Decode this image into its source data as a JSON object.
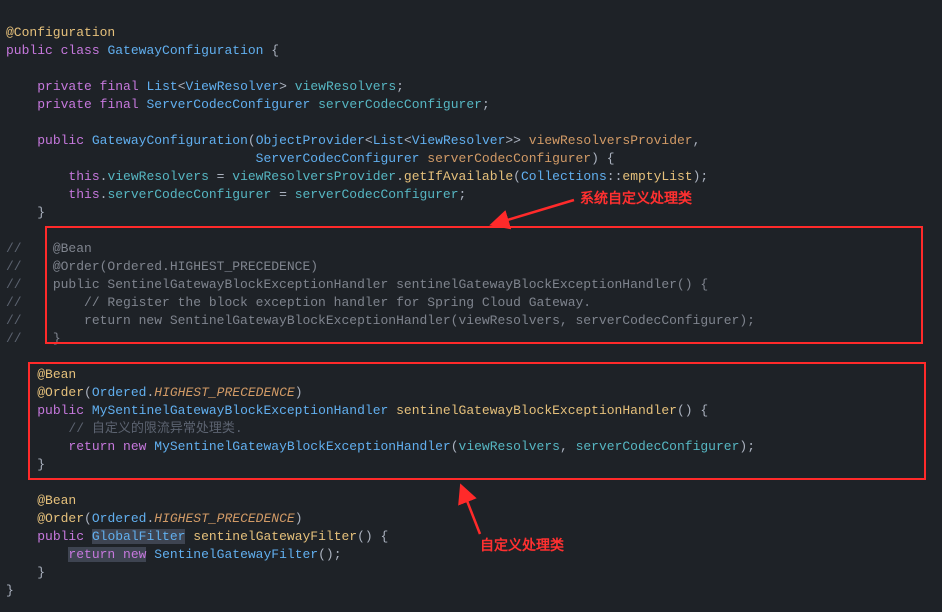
{
  "code": {
    "l1_ann": "@Configuration",
    "l2_kw_public": "public",
    "l2_kw_class": "class",
    "l2_type": "GatewayConfiguration",
    "l2_brace": " {",
    "l4_private": "private",
    "l4_final": "final",
    "l4_list": "List",
    "l4_vr": "ViewResolver",
    "l4_field": "viewResolvers",
    "l5_private": "private",
    "l5_final": "final",
    "l5_scc": "ServerCodecConfigurer",
    "l5_field": "serverCodecConfigurer",
    "l7_public": "public",
    "l7_ctor": "GatewayConfiguration",
    "l7_op": "ObjectProvider",
    "l7_list": "List",
    "l7_vr": "ViewResolver",
    "l7_p1": "viewResolversProvider",
    "l8_scc": "ServerCodecConfigurer",
    "l8_p2": "serverCodecConfigurer",
    "l8_brace": ") {",
    "l9_this": "this",
    "l9_vr": "viewResolvers",
    "l9_eq": " = ",
    "l9_p": "viewResolversProvider",
    "l9_m": "getIfAvailable",
    "l9_coll": "Collections",
    "l9_el": "emptyList",
    "l10_this": "this",
    "l10_scc": "serverCodecConfigurer",
    "l10_eq": " = ",
    "l10_p": "serverCodecConfigurer",
    "l11_brace": "}",
    "c_slash": "//",
    "c_bean": "    @Bean",
    "c_order": "    @Order(Ordered.HIGHEST_PRECEDENCE)",
    "c_sig": "    public SentinelGatewayBlockExceptionHandler sentinelGatewayBlockExceptionHandler() {",
    "c_reg": "        // Register the block exception handler for Spring Cloud Gateway.",
    "c_ret": "        return new SentinelGatewayBlockExceptionHandler(viewResolvers, serverCodecConfigurer);",
    "c_end": "    }",
    "b_bean": "@Bean",
    "b_order": "@Order",
    "b_ordered": "Ordered",
    "b_hp": "HIGHEST_PRECEDENCE",
    "b_public": "public",
    "b_type": "MySentinelGatewayBlockExceptionHandler",
    "b_mname": "sentinelGatewayBlockExceptionHandler",
    "b_brace": "() {",
    "b_cmt": "// 自定义的限流异常处理类.",
    "b_return": "return",
    "b_new": "new",
    "b_ctor": "MySentinelGatewayBlockExceptionHandler",
    "b_a1": "viewResolvers",
    "b_a2": "serverCodecConfigurer",
    "b_end": "}",
    "g_bean": "@Bean",
    "g_order": "@Order",
    "g_ordered": "Ordered",
    "g_hp": "HIGHEST_PRECEDENCE",
    "g_public": "public",
    "g_gf": "GlobalFilter",
    "g_mname": "sentinelGatewayFilter",
    "g_brace": "() {",
    "g_return": "return",
    "g_new": "new",
    "g_ctor": "SentinelGatewayFilter",
    "g_end": "}",
    "final_brace": "}"
  },
  "labels": {
    "sys": "系统自定义处理类",
    "custom": "自定义处理类"
  }
}
